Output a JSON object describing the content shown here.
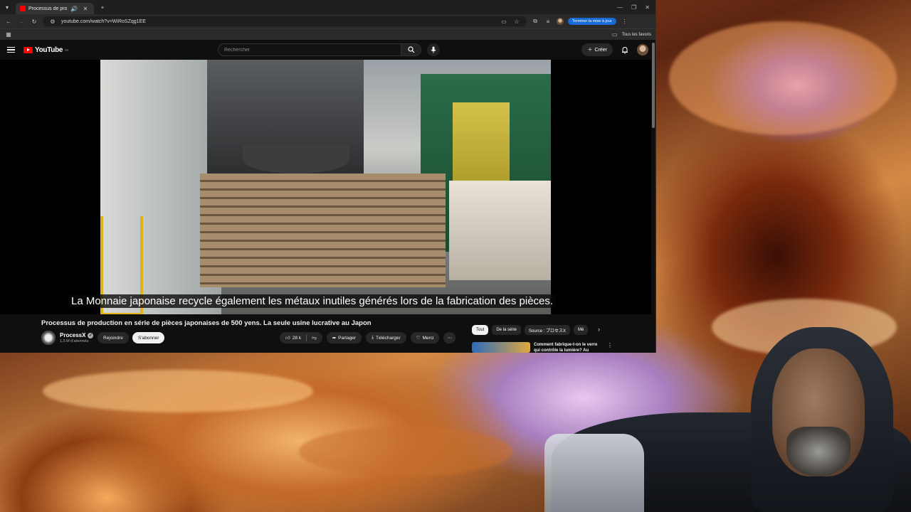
{
  "browser": {
    "tab_title": "Processus de production en s",
    "url": "youtube.com/watch?v=WiRoSZqg1EE",
    "update_button": "Terminer la mise à jour",
    "bookmarks_all": "Tous les favoris"
  },
  "youtube": {
    "logo_text": "YouTube",
    "logo_region": "FR",
    "search_placeholder": "Rechercher",
    "create_label": "Créer",
    "caption": "La Monnaie japonaise recycle également les métaux inutiles générés lors de la fabrication des pièces.",
    "video_title": "Processus de production en série de pièces japonaises de 500 yens. La seule usine lucrative au Japon",
    "channel_name": "ProcessX",
    "subscribers": "1,5 M d'abonnés",
    "join_label": "Rejoindre",
    "subscribe_label": "S'abonner",
    "like_count": "28 k",
    "share_label": "Partager",
    "download_label": "Télécharger",
    "thanks_label": "Merci",
    "chips": [
      "Tout",
      "De la série",
      "Source : プロセスX",
      "Mé"
    ],
    "recommendation_title": "Comment fabrique-t-on le verre qui contrôle la lumière? Au"
  },
  "icons": {
    "back": "arrow-left-icon",
    "forward": "arrow-right-icon",
    "reload": "reload-icon",
    "search": "search-icon",
    "mic": "microphone-icon",
    "bell": "bell-icon",
    "like": "thumbs-up-icon",
    "dislike": "thumbs-down-icon",
    "share": "share-icon",
    "download": "download-icon",
    "thanks": "heart-dollar-icon",
    "more": "more-dots-icon"
  },
  "colors": {
    "youtube_red": "#ff0000",
    "update_blue": "#1a6bd6",
    "dark_bg": "#0f0f0f"
  }
}
